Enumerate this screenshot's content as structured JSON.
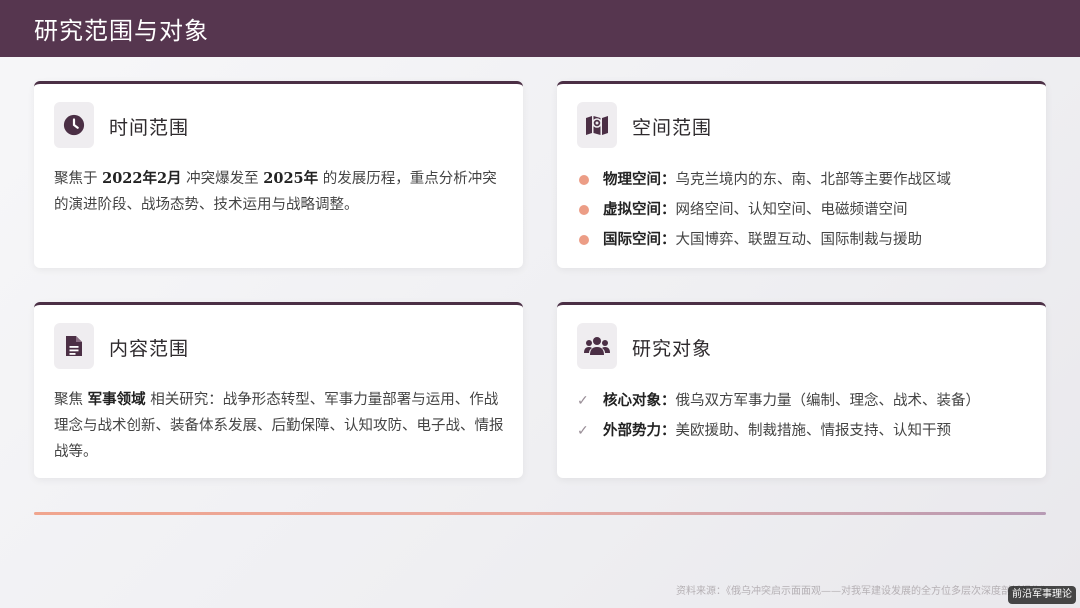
{
  "header": {
    "title": "研究范围与对象"
  },
  "cards": {
    "time": {
      "icon": "clock-icon",
      "title": "时间范围",
      "p1": "聚焦于 ",
      "b1": "2022年2月",
      "p2": " 冲突爆发至 ",
      "b2": "2025年",
      "p3": " 的发展历程，重点分析冲突的演进阶段、战场态势、技术运用与战略调整。"
    },
    "space": {
      "icon": "map-icon",
      "title": "空间范围",
      "items": [
        {
          "label": "物理空间：",
          "text": "乌克兰境内的东、南、北部等主要作战区域"
        },
        {
          "label": "虚拟空间：",
          "text": "网络空间、认知空间、电磁频谱空间"
        },
        {
          "label": "国际空间：",
          "text": "大国博弈、联盟互动、国际制裁与援助"
        }
      ]
    },
    "content": {
      "icon": "document-icon",
      "title": "内容范围",
      "p1": "聚焦 ",
      "b1": "军事领域",
      "p2": " 相关研究：战争形态转型、军事力量部署与运用、作战理念与战术创新、装备体系发展、后勤保障、认知攻防、电子战、情报战等。"
    },
    "objects": {
      "icon": "users-icon",
      "title": "研究对象",
      "items": [
        {
          "label": "核心对象：",
          "text": "俄乌双方军事力量（编制、理念、战术、装备）"
        },
        {
          "label": "外部势力：",
          "text": "美欧援助、制裁措施、情报支持、认知干预"
        }
      ]
    }
  },
  "footer": {
    "source": "资料来源：《俄乌冲突启示面面观——对我军建设发展的全方位多层次深度剖析报告》",
    "badge": "前沿军事理论"
  },
  "colors": {
    "header": "#56364f",
    "accent_dot": "#ec9d86",
    "card_border": "#4b2f45"
  }
}
